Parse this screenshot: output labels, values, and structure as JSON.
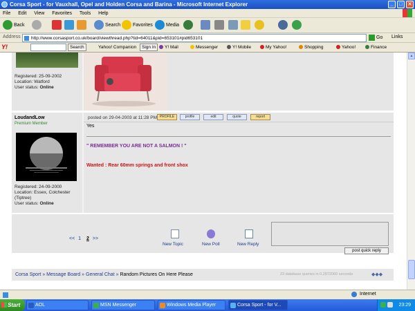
{
  "window": {
    "title": "Corsa Sport - for Vauxhall, Opel and Holden Corsa and Barina - Microsoft Internet Explorer",
    "minimize": "_",
    "maximize": "□",
    "close": "✕"
  },
  "menu": [
    "File",
    "Edit",
    "View",
    "Favorites",
    "Tools",
    "Help"
  ],
  "toolbar": {
    "back": "Back",
    "search": "Search",
    "favorites": "Favorites",
    "media": "Media"
  },
  "address": {
    "label": "Address",
    "url": "http://www.corsasport.co.uk/board/viewthread.php?tid=64011&pid=653101#pid653101",
    "go": "Go",
    "links": "Links"
  },
  "yahoo_bar": {
    "logo": "Y!",
    "search_btn": "Search",
    "companion": "Yahoo! Companion",
    "sign_in": "Sign In",
    "items": [
      "Y! Mail",
      "Messenger",
      "Y! Mobile",
      "My Yahoo!",
      "Shopping",
      "Yahoo!",
      "Finance"
    ]
  },
  "post1": {
    "registered": "Registered: 25-09-2002",
    "location": "Location: Watford",
    "status_label": "User status:",
    "status": "Online"
  },
  "post2": {
    "username": "LoudandLow",
    "rank": "Premium Member",
    "posted_on": "posted on 29-04-2003 at 11:28 PM",
    "action_buttons": [
      "PROFILE",
      "profile",
      "edit",
      "quote",
      "report"
    ],
    "body_short": "Yes",
    "quote_line": "\" REMEMBER YOU ARE NOT A SALMON ! \"",
    "wanted_line": "Wanted : Rear 60mm springs and front shox",
    "registered": "Registered: 24-09-2000",
    "location": "Location: Essex, Colchester (Tiptree)",
    "status_label": "User status:",
    "status": "Online",
    "colors": {
      "quote": "#7a2a9a",
      "wanted": "#cc1111"
    }
  },
  "pagination": {
    "prev": "<<",
    "page1": "1",
    "page2": "2",
    "next": ">>"
  },
  "footer_actions": {
    "new_topic": "New Topic",
    "new_poll": "New Poll",
    "new_reply": "New Reply",
    "quick_reply": "post quick reply"
  },
  "breadcrumb": {
    "items": [
      "Corsa Sport",
      "Message Board",
      "General Chat"
    ],
    "current": "Random Pictures On Here Please",
    "separator": "»",
    "queries": "23 database queries in 0.2872060 seconds",
    "dots": "◆◆◆"
  },
  "status_bar": {
    "zone": "Internet"
  },
  "taskbar": {
    "start": "Start",
    "tasks": [
      "AOL",
      "MSN Messenger",
      "Windows Media Player",
      "Corsa Sport - for V..."
    ],
    "clock": "23:29"
  }
}
